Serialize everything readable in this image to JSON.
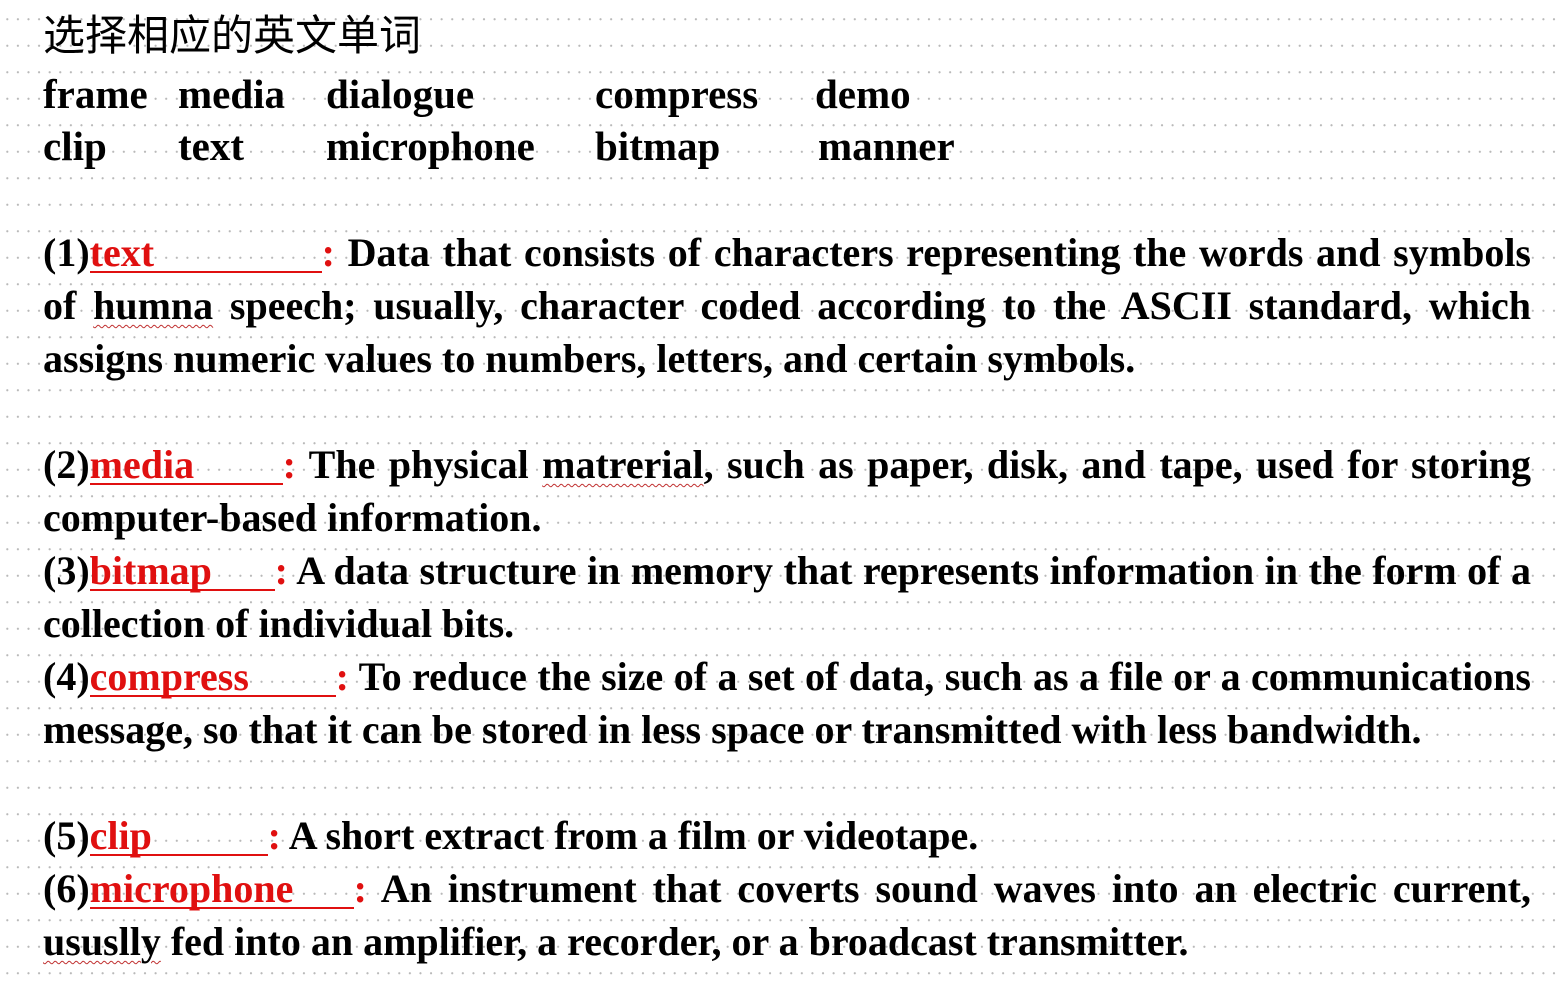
{
  "title": "选择相应的英文单词",
  "word_bank": {
    "row1": [
      "frame",
      "media",
      "dialogue",
      "compress",
      "demo"
    ],
    "row2": [
      "clip",
      "text",
      "microphone",
      "bitmap",
      "manner"
    ]
  },
  "colors": {
    "answer": "#e01010",
    "text": "#000000"
  },
  "items": [
    {
      "num": "(1)",
      "answer": "text",
      "colon": ":",
      "text_a": " Data that consists of characters representing the words and symbols of ",
      "misspelled": "humna",
      "text_b": " speech; usually, character coded according to the ASCII standard, which assigns numeric values to numbers, letters, and certain symbols."
    },
    {
      "num": "(2)",
      "answer": "media",
      "colon": ":",
      "text_a": " The physical ",
      "misspelled": "matrerial",
      "text_b": ", such as paper, disk, and tape, used for storing computer-based information."
    },
    {
      "num": "(3)",
      "answer": "bitmap",
      "colon": ":",
      "text_a": " A data structure in memory that represents information in the form of a collection of individual bits."
    },
    {
      "num": "(4)",
      "answer": "compress",
      "colon": ":",
      "text_a": " To reduce the size of a set of data, such as a file or a communications message, so that it can be stored in less space or transmitted with less bandwidth."
    },
    {
      "num": "(5)",
      "answer": "clip",
      "colon": ":",
      "text_a": " A short extract from a film or videotape."
    },
    {
      "num": "(6)",
      "answer": "microphone",
      "colon": ":",
      "text_a": "  An instrument that coverts sound waves into an electric current, ",
      "misspelled": "ususlly",
      "text_b": " fed into an amplifier, a recorder, or a broadcast transmitter."
    }
  ]
}
